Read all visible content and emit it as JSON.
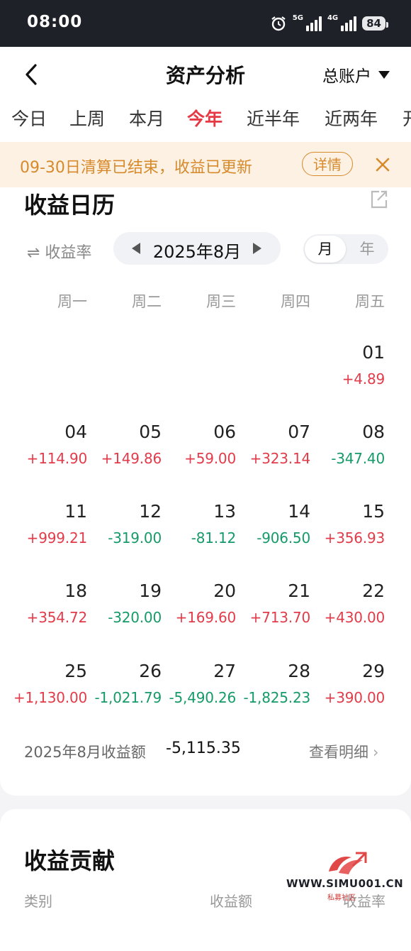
{
  "status_bar": {
    "time": "08:00",
    "net1": "5G",
    "net2": "4G",
    "battery": "84"
  },
  "header": {
    "title": "资产分析",
    "account": "总账户"
  },
  "tabs": [
    "今日",
    "上周",
    "本月",
    "今年",
    "近半年",
    "近两年",
    "开"
  ],
  "active_tab": "今年",
  "notice": {
    "text": "09-30日清算已结束，收益已更新",
    "detail": "详情"
  },
  "calendar": {
    "title": "收益日历",
    "rate_toggle": "⇌ 收益率",
    "month": "2025年8月",
    "view_month": "月",
    "view_year": "年",
    "weekdays": [
      "周一",
      "周二",
      "周三",
      "周四",
      "周五"
    ],
    "weeks": [
      [
        null,
        null,
        null,
        null,
        {
          "day": "01",
          "value": "+4.89",
          "sign": "pos"
        }
      ],
      [
        {
          "day": "04",
          "value": "+114.90",
          "sign": "pos"
        },
        {
          "day": "05",
          "value": "+149.86",
          "sign": "pos"
        },
        {
          "day": "06",
          "value": "+59.00",
          "sign": "pos"
        },
        {
          "day": "07",
          "value": "+323.14",
          "sign": "pos"
        },
        {
          "day": "08",
          "value": "-347.40",
          "sign": "neg"
        }
      ],
      [
        {
          "day": "11",
          "value": "+999.21",
          "sign": "pos"
        },
        {
          "day": "12",
          "value": "-319.00",
          "sign": "neg"
        },
        {
          "day": "13",
          "value": "-81.12",
          "sign": "neg"
        },
        {
          "day": "14",
          "value": "-906.50",
          "sign": "neg"
        },
        {
          "day": "15",
          "value": "+356.93",
          "sign": "pos"
        }
      ],
      [
        {
          "day": "18",
          "value": "+354.72",
          "sign": "pos"
        },
        {
          "day": "19",
          "value": "-320.00",
          "sign": "neg"
        },
        {
          "day": "20",
          "value": "+169.60",
          "sign": "pos"
        },
        {
          "day": "21",
          "value": "+713.70",
          "sign": "pos"
        },
        {
          "day": "22",
          "value": "+430.00",
          "sign": "pos"
        }
      ],
      [
        {
          "day": "25",
          "value": "+1,130.00",
          "sign": "pos"
        },
        {
          "day": "26",
          "value": "-1,021.79",
          "sign": "neg"
        },
        {
          "day": "27",
          "value": "-5,490.26",
          "sign": "neg"
        },
        {
          "day": "28",
          "value": "-1,825.23",
          "sign": "neg"
        },
        {
          "day": "29",
          "value": "+390.00",
          "sign": "pos"
        }
      ]
    ],
    "summary_label": "2025年8月收益额",
    "summary_value": "-5,115.35",
    "detail_link": "查看明细"
  },
  "contribution": {
    "title": "收益贡献",
    "col_category": "类别",
    "col_amount": "收益额",
    "col_rate": "收益率"
  },
  "watermark": {
    "text": "WWW.SIMU001.CN",
    "sub": "私募社区"
  },
  "colors": {
    "positive": "#e23b4a",
    "negative": "#159a6a",
    "accent": "#e63946",
    "notice": "#d68a2b"
  }
}
